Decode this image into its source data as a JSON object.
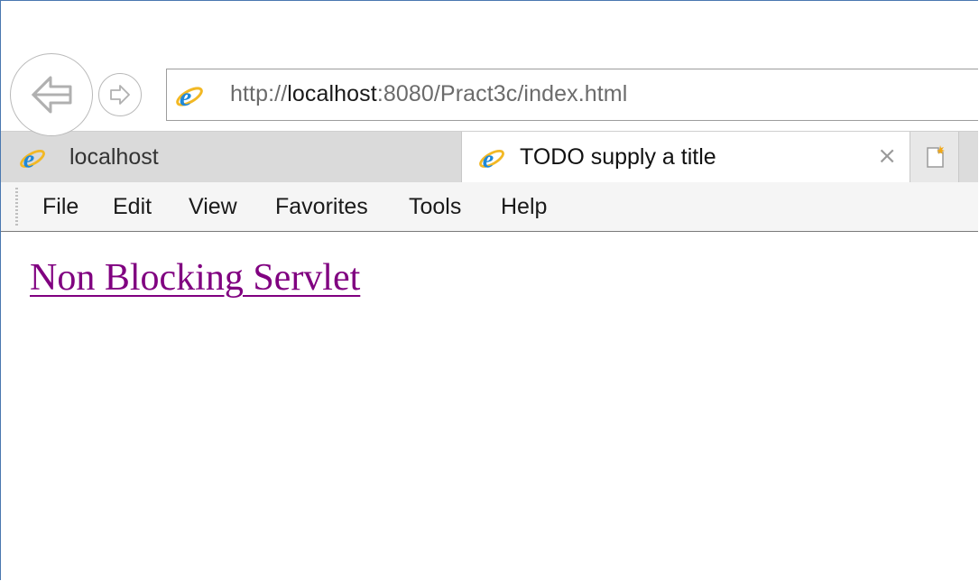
{
  "address_bar": {
    "url_prefix": "http://",
    "url_host": "localhost",
    "url_rest": ":8080/Pract3c/index.html"
  },
  "tabs": [
    {
      "label": "localhost",
      "active": false
    },
    {
      "label": "TODO supply a title",
      "active": true
    }
  ],
  "tab_close_glyph": "×",
  "menu": {
    "items": [
      "File",
      "Edit",
      "View",
      "Favorites",
      "Tools",
      "Help"
    ]
  },
  "content": {
    "link_text": "Non Blocking Servlet",
    "link_color": "#800080"
  },
  "icons": {
    "back": "back-arrow-icon",
    "forward": "forward-arrow-icon",
    "browser": "ie-logo-icon",
    "new_tab": "new-tab-icon",
    "close": "close-icon"
  }
}
